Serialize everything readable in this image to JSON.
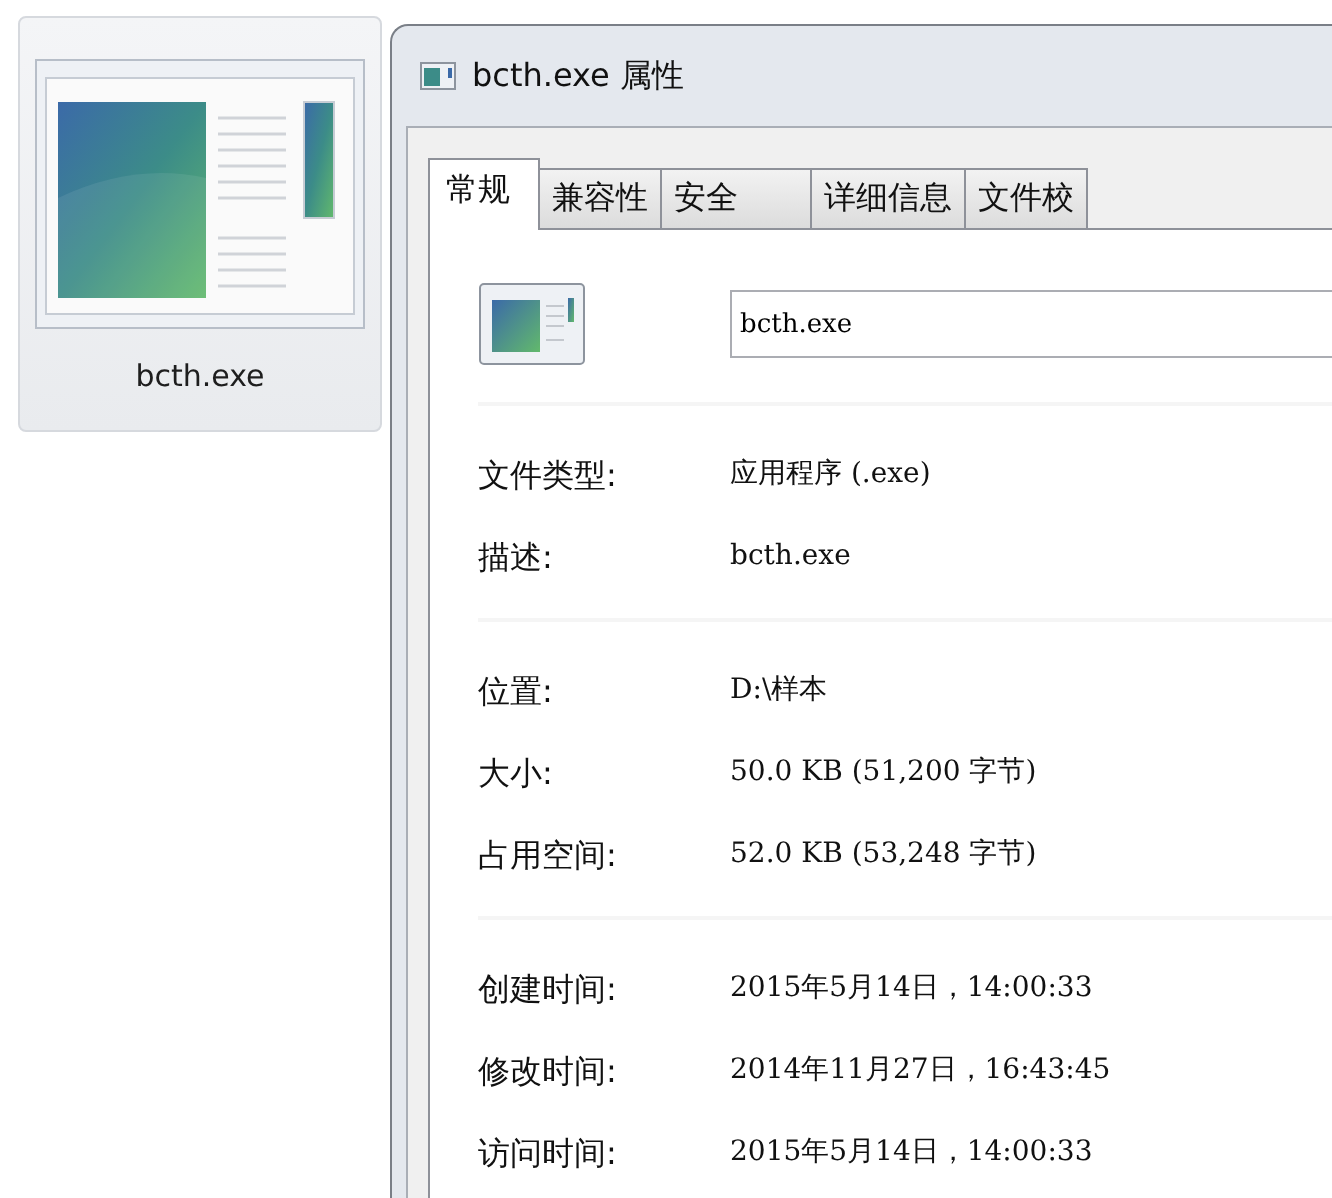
{
  "file_tile": {
    "name": "bcth.exe"
  },
  "window": {
    "title": "bcth.exe 属性"
  },
  "tabs": [
    {
      "label": "常规",
      "selected": true
    },
    {
      "label": "兼容性",
      "selected": false
    },
    {
      "label": "安全",
      "selected": false
    },
    {
      "label": "详细信息",
      "selected": false
    },
    {
      "label": "文件校",
      "selected": false
    }
  ],
  "general": {
    "file_name": "bcth.exe",
    "groups": [
      [
        {
          "label": "文件类型:",
          "value": "应用程序 (.exe)"
        },
        {
          "label": "描述:",
          "value": "bcth.exe"
        }
      ],
      [
        {
          "label": "位置:",
          "value": "D:\\样本"
        },
        {
          "label": "大小:",
          "value": "50.0 KB (51,200 字节)"
        },
        {
          "label": "占用空间:",
          "value": "52.0 KB (53,248 字节)"
        }
      ],
      [
        {
          "label": "创建时间:",
          "value": "2015年5月14日，14:00:33"
        },
        {
          "label": "修改时间:",
          "value": "2014年11月27日，16:43:45"
        },
        {
          "label": "访问时间:",
          "value": "2015年5月14日，14:00:33"
        }
      ]
    ]
  }
}
